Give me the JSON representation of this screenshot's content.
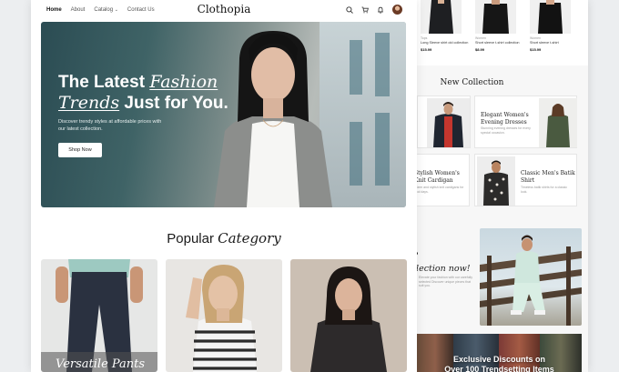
{
  "nav": {
    "links": [
      "Home",
      "About",
      "Catalog",
      "Contact Us"
    ],
    "logo": "Clothopia"
  },
  "hero": {
    "title_part1": "The Latest ",
    "title_em1": "Fashion",
    "title_em2": "Trends",
    "title_part2": " Just for You.",
    "subtitle": "Discover trendy styles at affordable prices with our latest collection.",
    "button": "Shop Now"
  },
  "popular": {
    "title_part1": "Popular ",
    "title_em": "Category",
    "cards": [
      "Versatile Pants"
    ]
  },
  "products": [
    {
      "tag": "Tops",
      "name": "Long Sleeve shirt old collection",
      "price": "$15.99"
    },
    {
      "tag": "Women",
      "name": "Short sleeve t-shirt collection",
      "price": "$8.99"
    },
    {
      "tag": "Women",
      "name": "Short sleeve t-shirt",
      "price": "$15.99"
    }
  ],
  "new_collection": {
    "title": "New Collection",
    "cards": [
      {
        "title": "Elegant Women's Evening Dresses",
        "desc": "Stunning evening dresses for every special occasion."
      },
      {
        "title": "Stylish Women's Knit Cardigan",
        "desc": "Warm and stylish knit cardigans for cool days."
      },
      {
        "title": "Classic Men's Batik Shirt",
        "desc": "Timeless batik shirts for a classic look."
      }
    ]
  },
  "promo": {
    "heading_line1": "?",
    "heading_line2": "llection now!",
    "desc": "Elevate your fashion with our carefully selected Discover unique pieces that suit you."
  },
  "banner": {
    "line1": "Exclusive Discounts on",
    "line2": "Over 100 Trendsetting Items"
  },
  "colors": {
    "accent": "#111111",
    "hero_dark": "#2b4c53",
    "page_bg": "#eceef0"
  }
}
